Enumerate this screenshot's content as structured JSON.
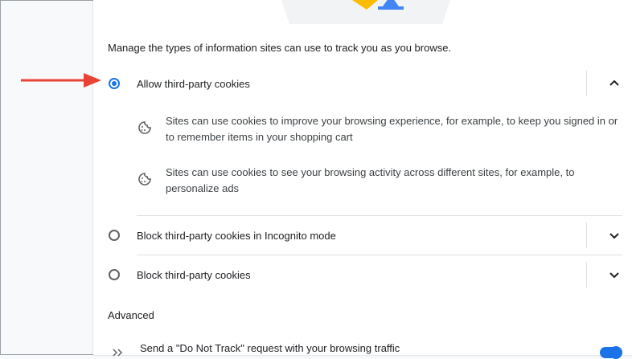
{
  "cookies": {
    "description": "Manage the types of information sites can use to track you as you browse.",
    "options": [
      {
        "label": "Allow third-party cookies",
        "selected": true,
        "expanded": true,
        "details": [
          {
            "icon": "cookie-icon",
            "line1": "Sites can use cookies to improve your browsing experience, for example, to keep you signed in or",
            "line2": "to remember items in your shopping cart"
          },
          {
            "icon": "cookie-icon",
            "line1": "Sites can use cookies to see your browsing activity across different sites, for example, to",
            "line2": "personalize ads"
          }
        ]
      },
      {
        "label": "Block third-party cookies in Incognito mode",
        "selected": false,
        "expanded": false
      },
      {
        "label": "Block third-party cookies",
        "selected": false,
        "expanded": false
      }
    ],
    "advanced": {
      "title": "Advanced",
      "do_not_track_label": "Send a \"Do Not Track\" request with your browsing traffic",
      "do_not_track_enabled": true
    }
  },
  "colors": {
    "accent": "#1a73e8",
    "annotation_arrow": "#ea4335",
    "illustration_yellow": "#fbbc04",
    "illustration_blue": "#4285f4"
  }
}
